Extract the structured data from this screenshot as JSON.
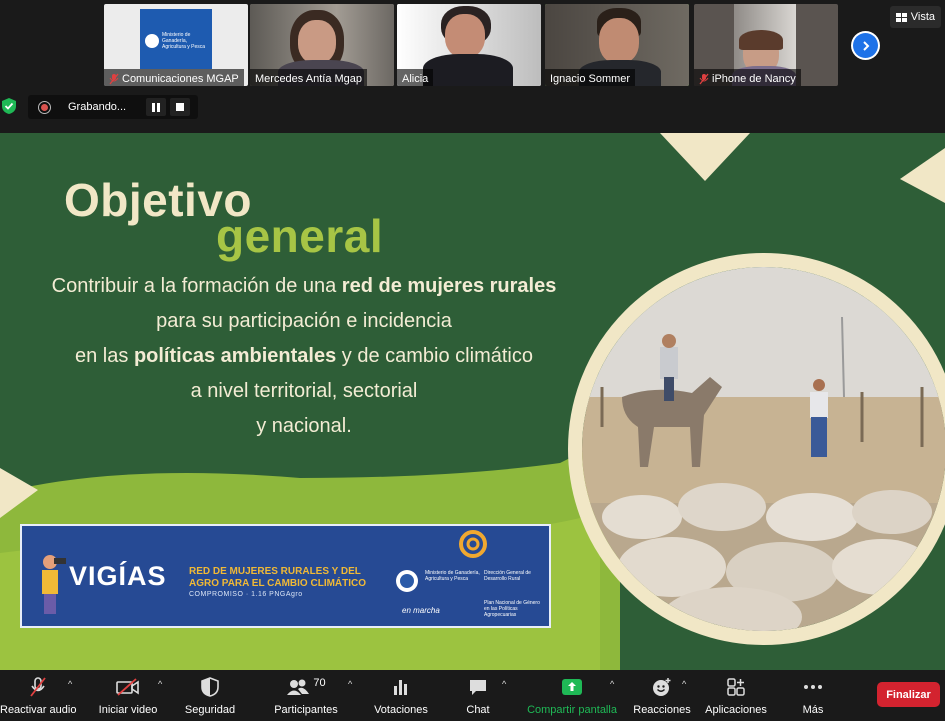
{
  "participants": [
    {
      "name": "Comunicaciones MGAP",
      "muted": true
    },
    {
      "name": "Mercedes Antía Mgap",
      "muted": false
    },
    {
      "name": "Alicia",
      "muted": false
    },
    {
      "name": "Ignacio Sommer",
      "muted": false
    },
    {
      "name": "iPhone de Nancy",
      "muted": true
    }
  ],
  "mgap_logo_text": "Ministerio de Ganadería, Agricultura y Pesca",
  "view_label": "Vista",
  "recording_label": "Grabando...",
  "slide": {
    "title_line1": "Objetivo",
    "title_line2": "general",
    "body_line1_a": "Contribuir a la formación de una ",
    "body_line1_b": "red de mujeres rurales",
    "body_line2": "para su participación e incidencia",
    "body_line3_a": "en las ",
    "body_line3_b": "políticas ambientales",
    "body_line3_c": " y de cambio climático",
    "body_line4": "a nivel territorial, sectorial",
    "body_line5": "y nacional.",
    "banner": {
      "brand": "VIGÍAS",
      "headline": "RED DE MUJERES RURALES Y DEL AGRO PARA EL CAMBIO CLIMÁTICO",
      "commitment": "COMPROMISO · 1.16 PNGAgro",
      "ministry": "Ministerio de Ganadería, Agricultura y Pesca",
      "direction": "Dirección General de Desarrollo Rural",
      "plan": "Plan Nacional de Género en las Políticas Agropecuarias",
      "tagline": "en marcha"
    }
  },
  "toolbar": {
    "audio": "Reactivar audio",
    "video": "Iniciar video",
    "security": "Seguridad",
    "participants": "Participantes",
    "participants_count": "70",
    "polls": "Votaciones",
    "chat": "Chat",
    "share": "Compartir pantalla",
    "reactions": "Reacciones",
    "apps": "Aplicaciones",
    "more": "Más",
    "end": "Finalizar"
  },
  "colors": {
    "slide_green": "#2e5e37",
    "lime": "#a7c545",
    "cream": "#f1e7c6",
    "share_green": "#1fb956",
    "end_red": "#d3232f"
  }
}
